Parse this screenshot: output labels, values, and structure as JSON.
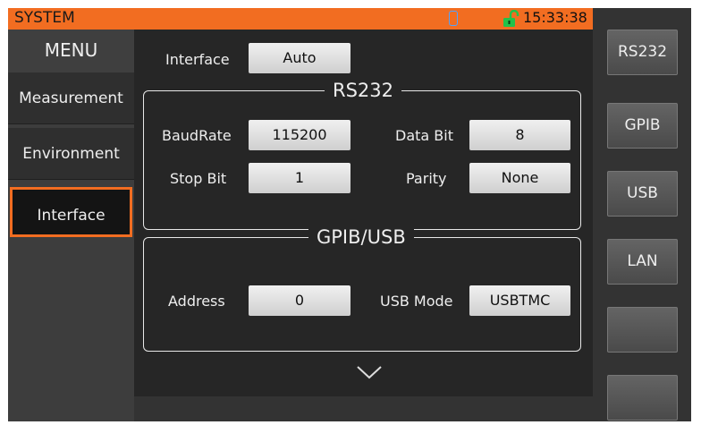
{
  "topbar": {
    "title": "SYSTEM",
    "time": "15:33:38",
    "accent_color": "#f26d21",
    "icons": [
      "usb-drive-icon",
      "unlocked-padlock-icon"
    ]
  },
  "menu": {
    "title": "MENU",
    "items": [
      {
        "label": "Measurement",
        "selected": false
      },
      {
        "label": "Environment",
        "selected": false
      },
      {
        "label": "Interface",
        "selected": true
      }
    ]
  },
  "interface": {
    "label": "Interface",
    "value": "Auto"
  },
  "rs232": {
    "title": "RS232",
    "baudrate_label": "BaudRate",
    "baudrate_value": "115200",
    "databit_label": "Data Bit",
    "databit_value": "8",
    "stopbit_label": "Stop Bit",
    "stopbit_value": "1",
    "parity_label": "Parity",
    "parity_value": "None"
  },
  "gpib_usb": {
    "title": "GPIB/USB",
    "address_label": "Address",
    "address_value": "0",
    "usbmode_label": "USB Mode",
    "usbmode_value": "USBTMC"
  },
  "softkeys": [
    "RS232",
    "GPIB",
    "USB",
    "LAN",
    "",
    ""
  ],
  "scroll_icon": "chevron-down-icon"
}
